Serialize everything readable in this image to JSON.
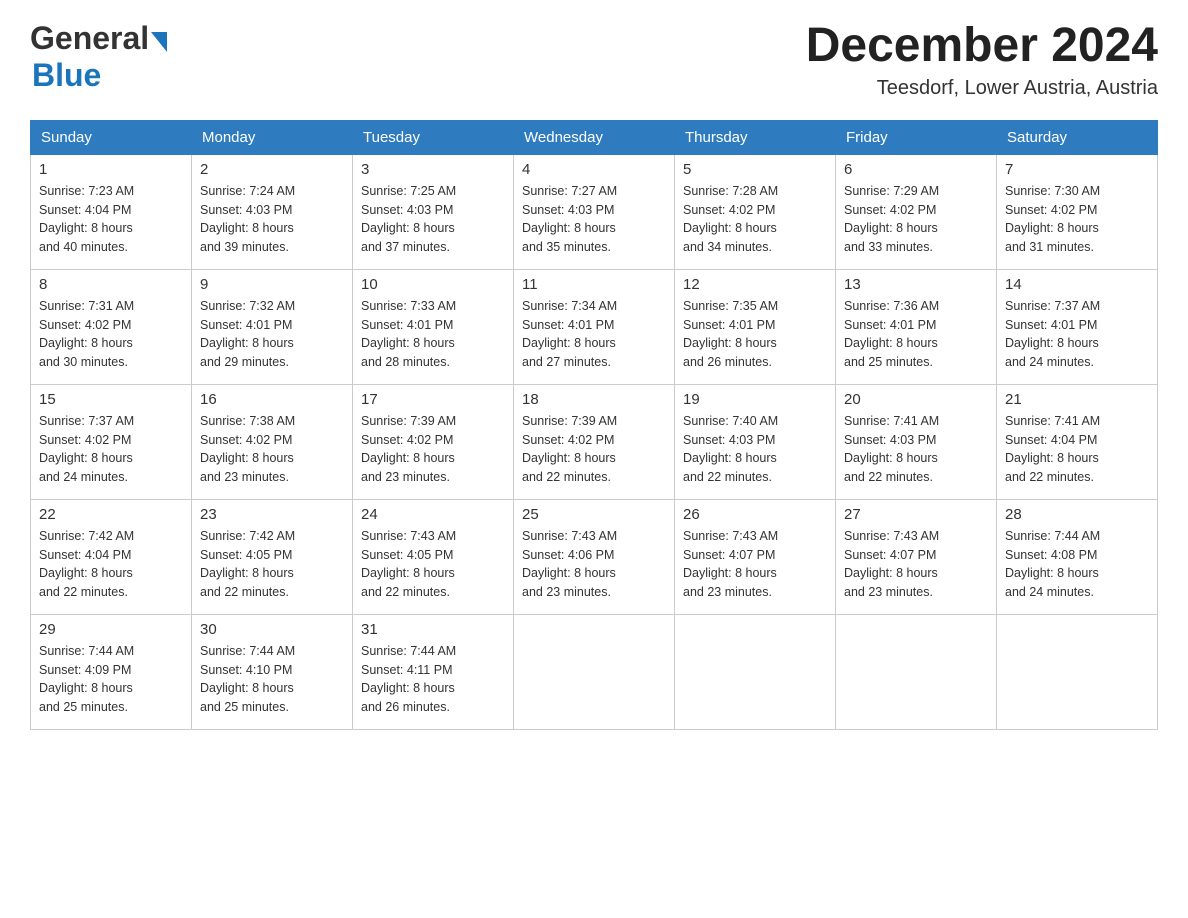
{
  "logo": {
    "line1": "General",
    "arrow": "▶",
    "line2": "Blue"
  },
  "title": "December 2024",
  "location": "Teesdorf, Lower Austria, Austria",
  "days_of_week": [
    "Sunday",
    "Monday",
    "Tuesday",
    "Wednesday",
    "Thursday",
    "Friday",
    "Saturday"
  ],
  "weeks": [
    [
      {
        "day": "1",
        "sunrise": "7:23 AM",
        "sunset": "4:04 PM",
        "daylight": "8 hours and 40 minutes."
      },
      {
        "day": "2",
        "sunrise": "7:24 AM",
        "sunset": "4:03 PM",
        "daylight": "8 hours and 39 minutes."
      },
      {
        "day": "3",
        "sunrise": "7:25 AM",
        "sunset": "4:03 PM",
        "daylight": "8 hours and 37 minutes."
      },
      {
        "day": "4",
        "sunrise": "7:27 AM",
        "sunset": "4:03 PM",
        "daylight": "8 hours and 35 minutes."
      },
      {
        "day": "5",
        "sunrise": "7:28 AM",
        "sunset": "4:02 PM",
        "daylight": "8 hours and 34 minutes."
      },
      {
        "day": "6",
        "sunrise": "7:29 AM",
        "sunset": "4:02 PM",
        "daylight": "8 hours and 33 minutes."
      },
      {
        "day": "7",
        "sunrise": "7:30 AM",
        "sunset": "4:02 PM",
        "daylight": "8 hours and 31 minutes."
      }
    ],
    [
      {
        "day": "8",
        "sunrise": "7:31 AM",
        "sunset": "4:02 PM",
        "daylight": "8 hours and 30 minutes."
      },
      {
        "day": "9",
        "sunrise": "7:32 AM",
        "sunset": "4:01 PM",
        "daylight": "8 hours and 29 minutes."
      },
      {
        "day": "10",
        "sunrise": "7:33 AM",
        "sunset": "4:01 PM",
        "daylight": "8 hours and 28 minutes."
      },
      {
        "day": "11",
        "sunrise": "7:34 AM",
        "sunset": "4:01 PM",
        "daylight": "8 hours and 27 minutes."
      },
      {
        "day": "12",
        "sunrise": "7:35 AM",
        "sunset": "4:01 PM",
        "daylight": "8 hours and 26 minutes."
      },
      {
        "day": "13",
        "sunrise": "7:36 AM",
        "sunset": "4:01 PM",
        "daylight": "8 hours and 25 minutes."
      },
      {
        "day": "14",
        "sunrise": "7:37 AM",
        "sunset": "4:01 PM",
        "daylight": "8 hours and 24 minutes."
      }
    ],
    [
      {
        "day": "15",
        "sunrise": "7:37 AM",
        "sunset": "4:02 PM",
        "daylight": "8 hours and 24 minutes."
      },
      {
        "day": "16",
        "sunrise": "7:38 AM",
        "sunset": "4:02 PM",
        "daylight": "8 hours and 23 minutes."
      },
      {
        "day": "17",
        "sunrise": "7:39 AM",
        "sunset": "4:02 PM",
        "daylight": "8 hours and 23 minutes."
      },
      {
        "day": "18",
        "sunrise": "7:39 AM",
        "sunset": "4:02 PM",
        "daylight": "8 hours and 22 minutes."
      },
      {
        "day": "19",
        "sunrise": "7:40 AM",
        "sunset": "4:03 PM",
        "daylight": "8 hours and 22 minutes."
      },
      {
        "day": "20",
        "sunrise": "7:41 AM",
        "sunset": "4:03 PM",
        "daylight": "8 hours and 22 minutes."
      },
      {
        "day": "21",
        "sunrise": "7:41 AM",
        "sunset": "4:04 PM",
        "daylight": "8 hours and 22 minutes."
      }
    ],
    [
      {
        "day": "22",
        "sunrise": "7:42 AM",
        "sunset": "4:04 PM",
        "daylight": "8 hours and 22 minutes."
      },
      {
        "day": "23",
        "sunrise": "7:42 AM",
        "sunset": "4:05 PM",
        "daylight": "8 hours and 22 minutes."
      },
      {
        "day": "24",
        "sunrise": "7:43 AM",
        "sunset": "4:05 PM",
        "daylight": "8 hours and 22 minutes."
      },
      {
        "day": "25",
        "sunrise": "7:43 AM",
        "sunset": "4:06 PM",
        "daylight": "8 hours and 23 minutes."
      },
      {
        "day": "26",
        "sunrise": "7:43 AM",
        "sunset": "4:07 PM",
        "daylight": "8 hours and 23 minutes."
      },
      {
        "day": "27",
        "sunrise": "7:43 AM",
        "sunset": "4:07 PM",
        "daylight": "8 hours and 23 minutes."
      },
      {
        "day": "28",
        "sunrise": "7:44 AM",
        "sunset": "4:08 PM",
        "daylight": "8 hours and 24 minutes."
      }
    ],
    [
      {
        "day": "29",
        "sunrise": "7:44 AM",
        "sunset": "4:09 PM",
        "daylight": "8 hours and 25 minutes."
      },
      {
        "day": "30",
        "sunrise": "7:44 AM",
        "sunset": "4:10 PM",
        "daylight": "8 hours and 25 minutes."
      },
      {
        "day": "31",
        "sunrise": "7:44 AM",
        "sunset": "4:11 PM",
        "daylight": "8 hours and 26 minutes."
      },
      null,
      null,
      null,
      null
    ]
  ],
  "labels": {
    "sunrise": "Sunrise:",
    "sunset": "Sunset:",
    "daylight": "Daylight:"
  }
}
